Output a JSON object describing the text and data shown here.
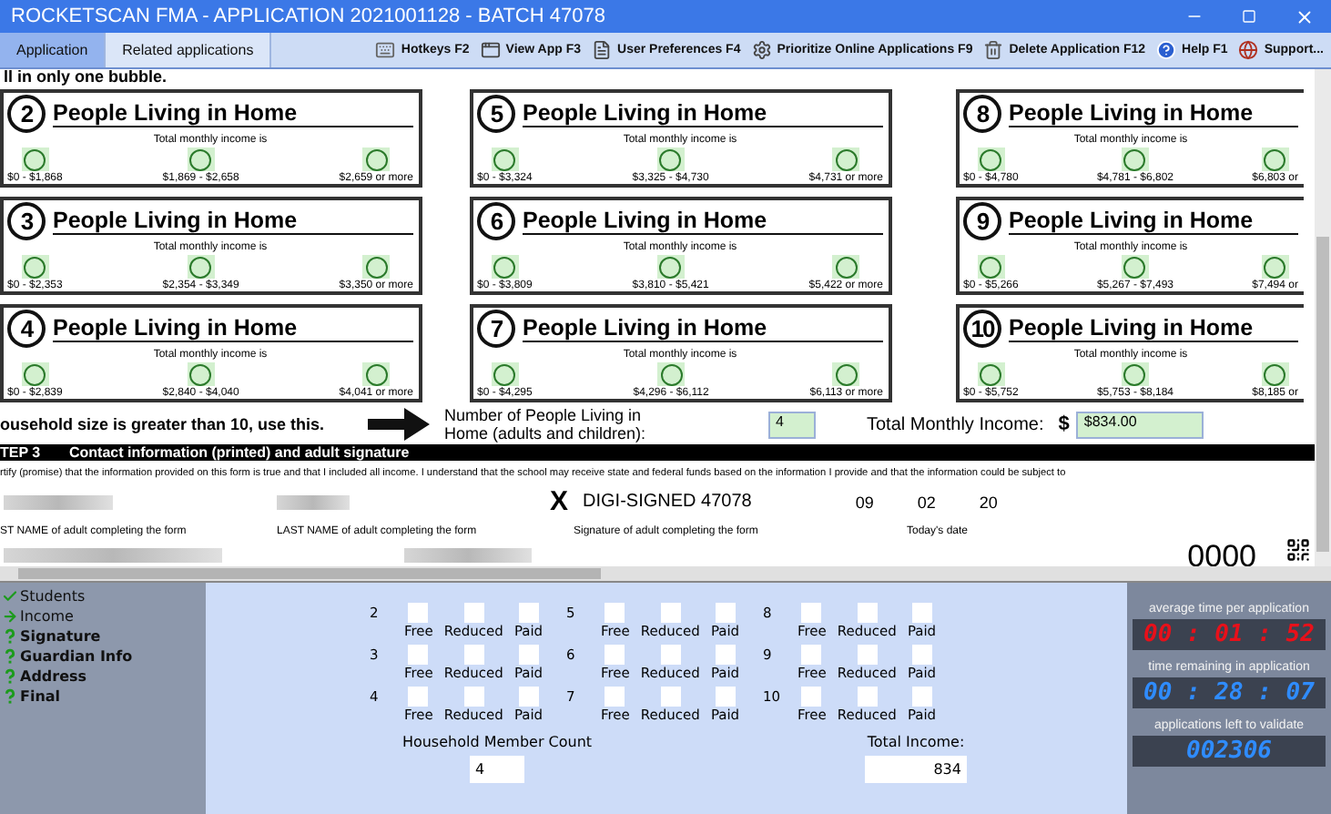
{
  "window": {
    "title": "ROCKETSCAN FMA - APPLICATION 2021001128 - BATCH 47078"
  },
  "tabs": [
    {
      "label": "Application",
      "selected": true
    },
    {
      "label": "Related applications",
      "selected": false
    }
  ],
  "toolbar": [
    {
      "kind": "hotkeys",
      "label": "Hotkeys F2"
    },
    {
      "kind": "view",
      "label": "View App F3"
    },
    {
      "kind": "prefs",
      "label": "User Preferences F4"
    },
    {
      "kind": "prioritize",
      "label": "Prioritize Online Applications F9"
    },
    {
      "kind": "delete",
      "label": "Delete Application F12"
    },
    {
      "kind": "help",
      "label": "Help F1"
    },
    {
      "kind": "support",
      "label": "Support..."
    }
  ],
  "form": {
    "instruction": "ll in only one bubble.",
    "cards": [
      {
        "number": "2",
        "title": "People Living in Home",
        "subtitle": "Total monthly income is",
        "ranges": [
          "$0 - $1,868",
          "$1,869 - $2,658",
          "$2,659 or more"
        ]
      },
      {
        "number": "5",
        "title": "People Living in Home",
        "subtitle": "Total monthly income is",
        "ranges": [
          "$0 - $3,324",
          "$3,325 - $4,730",
          "$4,731 or more"
        ]
      },
      {
        "number": "8",
        "title": "People Living in Home",
        "subtitle": "Total monthly income is",
        "ranges": [
          "$0 - $4,780",
          "$4,781 - $6,802",
          "$6,803 or"
        ]
      },
      {
        "number": "3",
        "title": "People Living in Home",
        "subtitle": "Total monthly income is",
        "ranges": [
          "$0 - $2,353",
          "$2,354 - $3,349",
          "$3,350 or more"
        ]
      },
      {
        "number": "6",
        "title": "People Living in Home",
        "subtitle": "Total monthly income is",
        "ranges": [
          "$0 - $3,809",
          "$3,810 - $5,421",
          "$5,422 or more"
        ]
      },
      {
        "number": "9",
        "title": "People Living in Home",
        "subtitle": "Total monthly income is",
        "ranges": [
          "$0 - $5,266",
          "$5,267 - $7,493",
          "$7,494 or"
        ]
      },
      {
        "number": "4",
        "title": "People Living in Home",
        "subtitle": "Total monthly income is",
        "ranges": [
          "$0 - $2,839",
          "$2,840 - $4,040",
          "$4,041 or more"
        ]
      },
      {
        "number": "7",
        "title": "People Living in Home",
        "subtitle": "Total monthly income is",
        "ranges": [
          "$0 - $4,295",
          "$4,296 - $6,112",
          "$6,113 or more"
        ]
      },
      {
        "number": "10",
        "title": "People Living in Home",
        "subtitle": "Total monthly income is",
        "ranges": [
          "$0 - $5,752",
          "$5,753 - $8,184",
          "$8,185 or"
        ]
      }
    ],
    "large_household": "ousehold size is greater than 10, use this.",
    "people_label": "Number of People Living in Home (adults and children):",
    "people_value": "4",
    "income_label": "Total Monthly Income:",
    "currency": "$",
    "income_value": "$834.00",
    "step_number": "TEP 3",
    "step_title": "Contact information (printed) and adult signature",
    "certify": "rtify (promise) that the information provided on this form is true and that I included all income. I understand that the school may receive state and federal funds based on the information I provide and that the information could be subject to",
    "signature_mark": "X",
    "signature": "DIGI-SIGNED 47078",
    "date": [
      "09",
      "02",
      "20"
    ],
    "field_labels": [
      "ST NAME of adult completing the form",
      "LAST NAME of adult completing the form",
      "Signature of adult completing the form",
      "Today's date"
    ],
    "code": "0000"
  },
  "steps": [
    {
      "label": "Students",
      "kind": "done"
    },
    {
      "label": "Income",
      "kind": "current"
    },
    {
      "label": "Signature",
      "kind": "pending"
    },
    {
      "label": "Guardian Info",
      "kind": "pending"
    },
    {
      "label": "Address",
      "kind": "pending"
    },
    {
      "label": "Final",
      "kind": "pending"
    }
  ],
  "size_groups": [
    {
      "size": "2",
      "options": [
        {
          "label": "Free",
          "checked": false
        },
        {
          "label": "Reduced",
          "checked": false
        },
        {
          "label": "Paid",
          "checked": false
        }
      ]
    },
    {
      "size": "5",
      "options": [
        {
          "label": "Free",
          "checked": false
        },
        {
          "label": "Reduced",
          "checked": false
        },
        {
          "label": "Paid",
          "checked": false
        }
      ]
    },
    {
      "size": "8",
      "options": [
        {
          "label": "Free",
          "checked": false
        },
        {
          "label": "Reduced",
          "checked": false
        },
        {
          "label": "Paid",
          "checked": false
        }
      ]
    },
    {
      "size": "3",
      "options": [
        {
          "label": "Free",
          "checked": false
        },
        {
          "label": "Reduced",
          "checked": false
        },
        {
          "label": "Paid",
          "checked": false
        }
      ]
    },
    {
      "size": "6",
      "options": [
        {
          "label": "Free",
          "checked": false
        },
        {
          "label": "Reduced",
          "checked": false
        },
        {
          "label": "Paid",
          "checked": false
        }
      ]
    },
    {
      "size": "9",
      "options": [
        {
          "label": "Free",
          "checked": false
        },
        {
          "label": "Reduced",
          "checked": false
        },
        {
          "label": "Paid",
          "checked": false
        }
      ]
    },
    {
      "size": "4",
      "options": [
        {
          "label": "Free",
          "checked": false
        },
        {
          "label": "Reduced",
          "checked": false
        },
        {
          "label": "Paid",
          "checked": false
        }
      ]
    },
    {
      "size": "7",
      "options": [
        {
          "label": "Free",
          "checked": false
        },
        {
          "label": "Reduced",
          "checked": false
        },
        {
          "label": "Paid",
          "checked": false
        }
      ]
    },
    {
      "size": "10",
      "options": [
        {
          "label": "Free",
          "checked": false
        },
        {
          "label": "Reduced",
          "checked": false
        },
        {
          "label": "Paid",
          "checked": false
        }
      ]
    }
  ],
  "member_count": {
    "label": "Household Member Count",
    "value": "4"
  },
  "total_income": {
    "label": "Total Income:",
    "value": "834"
  },
  "stats": [
    {
      "label": "average time per application",
      "value": "00 : 01 : 52",
      "color": "#e8101a"
    },
    {
      "label": "time remaining in application",
      "value": "00 : 28 : 07",
      "color": "#2f8cff"
    },
    {
      "label": "applications left to validate",
      "value": "002306",
      "color": "#2f8cff"
    }
  ]
}
